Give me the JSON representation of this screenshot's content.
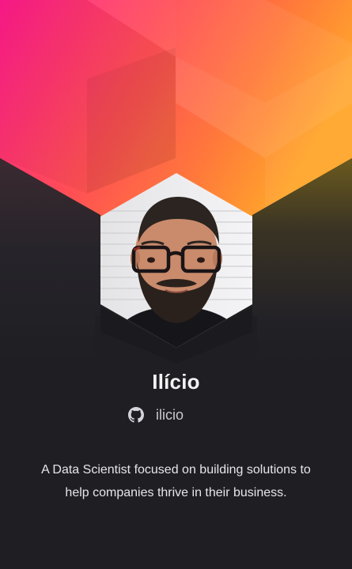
{
  "profile": {
    "name": "Ilício",
    "github_handle": "ilicio",
    "bio": "A Data Scientist focused on building solutions to help companies thrive in their business."
  },
  "icons": {
    "github": "github-icon"
  },
  "colors": {
    "background": "#1f1f23",
    "gradient_start": "#ff1a8c",
    "gradient_mid": "#ff5a4a",
    "gradient_end": "#ffa62b",
    "text_primary": "#f2f2f4",
    "text_secondary": "#c9c9cf"
  }
}
